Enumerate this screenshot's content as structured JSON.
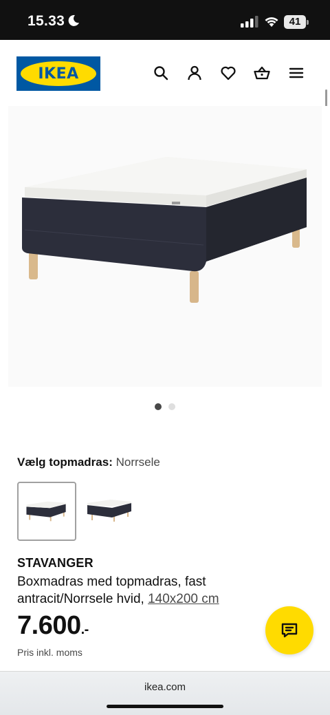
{
  "status_bar": {
    "time": "15.33",
    "battery": "41"
  },
  "header": {
    "logo_text": "IKEA"
  },
  "product": {
    "select_label": "Vælg topmadras:",
    "select_value": "Norrsele",
    "name": "STAVANGER",
    "description_line1": "Boxmadras med topmadras, fast",
    "description_line2": "antracit/Norrsele hvid,",
    "size": "140x200 cm",
    "price": "7.600",
    "price_suffix": ".-",
    "price_note": "Pris inkl. moms"
  },
  "carousel": {
    "count": 2,
    "active_index": 0
  },
  "browser": {
    "url": "ikea.com"
  },
  "colors": {
    "ikea_blue": "#0058a3",
    "ikea_yellow": "#ffdb00",
    "bed_base": "#2b2d3a",
    "mattress": "#f1f1ee",
    "legs": "#d7b68a"
  },
  "icons": [
    "moon-icon",
    "signal-icon",
    "wifi-icon",
    "battery-icon",
    "search-icon",
    "user-icon",
    "heart-icon",
    "basket-icon",
    "menu-icon",
    "chat-icon"
  ]
}
